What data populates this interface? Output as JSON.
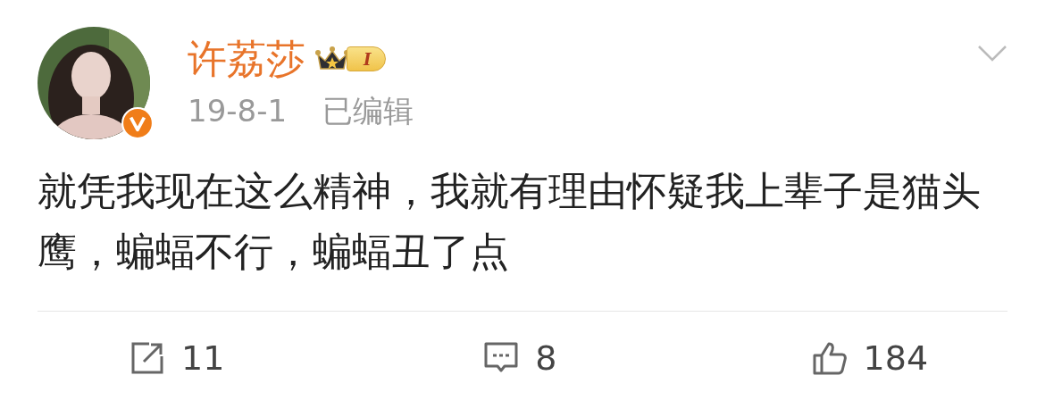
{
  "post": {
    "author": "许荔莎",
    "level_badge": "I",
    "verified": true,
    "time": "19-8-1",
    "edited_label": "已编辑",
    "text": "就凭我现在这么精神，我就有理由怀疑我上辈子是猫头鹰，蝙蝠不行，蝙蝠丑了点"
  },
  "actions": [
    {
      "kind": "repost",
      "count": "11"
    },
    {
      "kind": "comment",
      "count": "8"
    },
    {
      "kind": "like",
      "count": "184"
    }
  ]
}
